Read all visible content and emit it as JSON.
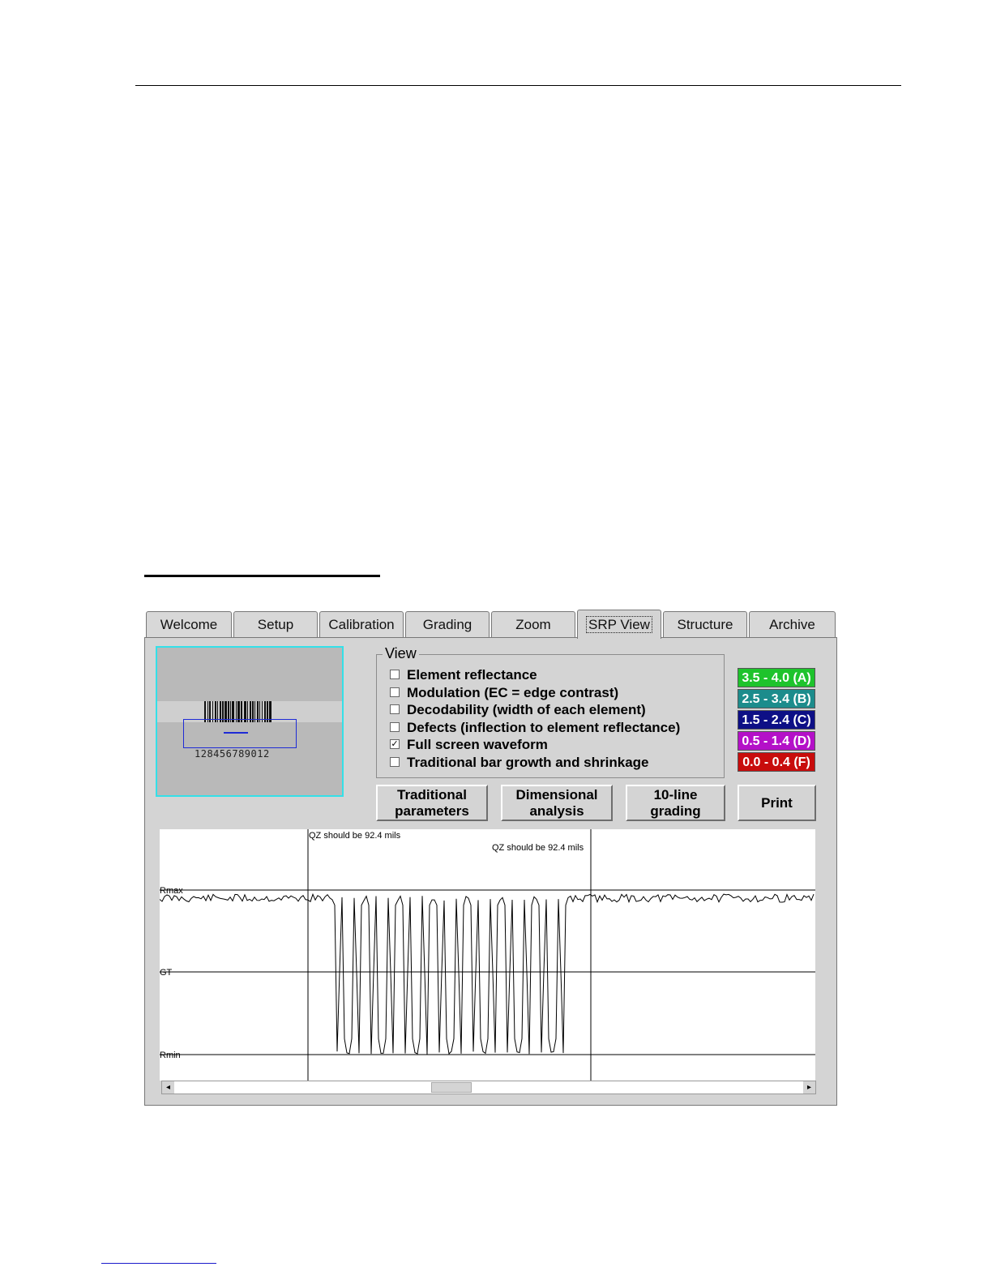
{
  "tabs": [
    "Welcome",
    "Setup",
    "Calibration",
    "Grading",
    "Zoom",
    "SRP View",
    "Structure",
    "Archive"
  ],
  "active_tab": "SRP View",
  "thumbnail": {
    "digits": "128456789012"
  },
  "view": {
    "title": "View",
    "options": [
      {
        "label": "Element reflectance",
        "checked": false
      },
      {
        "label": "Modulation (EC = edge contrast)",
        "checked": false
      },
      {
        "label": "Decodability (width of each element)",
        "checked": false
      },
      {
        "label": "Defects (inflection to element reflectance)",
        "checked": false
      },
      {
        "label": "Full screen waveform",
        "checked": true
      },
      {
        "label": "Traditional bar growth and shrinkage",
        "checked": false
      }
    ]
  },
  "grades": [
    {
      "label": "3.5 - 4.0 (A)",
      "color": "#1ec32c"
    },
    {
      "label": "2.5 - 3.4 (B)",
      "color": "#1c8c8c"
    },
    {
      "label": "1.5 - 2.4 (C)",
      "color": "#0d0f86"
    },
    {
      "label": "0.5 - 1.4 (D)",
      "color": "#b410c8"
    },
    {
      "label": "0.0 - 0.4 (F)",
      "color": "#c80c0c"
    }
  ],
  "buttons": {
    "traditional": [
      "Traditional",
      "parameters"
    ],
    "dimensional": [
      "Dimensional",
      "analysis"
    ],
    "tenline": [
      "10-line",
      "grading"
    ],
    "print": "Print"
  },
  "waveform": {
    "qz_left": "QZ should be 92.4 mils",
    "qz_right": "QZ should be 92.4 mils",
    "rmax": "Rmax",
    "gt": "GT",
    "rmin": "Rmin"
  },
  "scrollbar": {
    "left_arrow": "◂",
    "right_arrow": "▸"
  }
}
